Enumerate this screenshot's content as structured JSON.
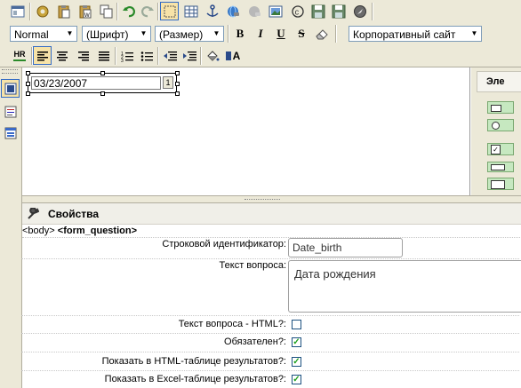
{
  "toolbar1": {
    "icons": [
      "source-view-icon",
      "settings-gear-icon",
      "paste-icon",
      "paste-special-icon",
      "copy-icon",
      "undo-icon",
      "redo-icon",
      "select-box-icon",
      "table-icon",
      "anchor-icon",
      "link-icon",
      "unlink-icon",
      "image-icon",
      "copyright-icon",
      "save-icon",
      "save-as-icon",
      "browse-icon"
    ]
  },
  "toolbar2": {
    "style_value": "Normal",
    "font_value": "(Шрифт)",
    "size_value": "(Размер)",
    "bold_label": "B",
    "italic_label": "I",
    "underline_label": "U",
    "strike_label": "S",
    "template_value": "Корпоративный сайт"
  },
  "toolbar3": {
    "hr_label": "HR",
    "font_color_label": "A"
  },
  "editor": {
    "date_value": "03/23/2007",
    "calendar_btn": "1"
  },
  "right_panel": {
    "title": "Эле"
  },
  "properties": {
    "header": "Свойства",
    "breadcrumb_body": "<body>",
    "breadcrumb_tag": "<form_question>",
    "fields": {
      "string_id_label": "Строковой идентификатор:",
      "string_id_value": "Date_birth",
      "question_text_label": "Текст вопроса:",
      "question_text_value": "Дата рождения",
      "question_html_label": "Текст вопроса - HTML?:",
      "required_label": "Обязателен?:",
      "show_html_label": "Показать в HTML-таблице результатов?:",
      "show_excel_label": "Показать в Excel-таблице результатов?:"
    }
  },
  "colors": {
    "toolbar_bg": "#ece9d8",
    "selected_border": "#316ac5",
    "check_green": "#21a121",
    "panel_header_bg": "#f0efe8"
  }
}
